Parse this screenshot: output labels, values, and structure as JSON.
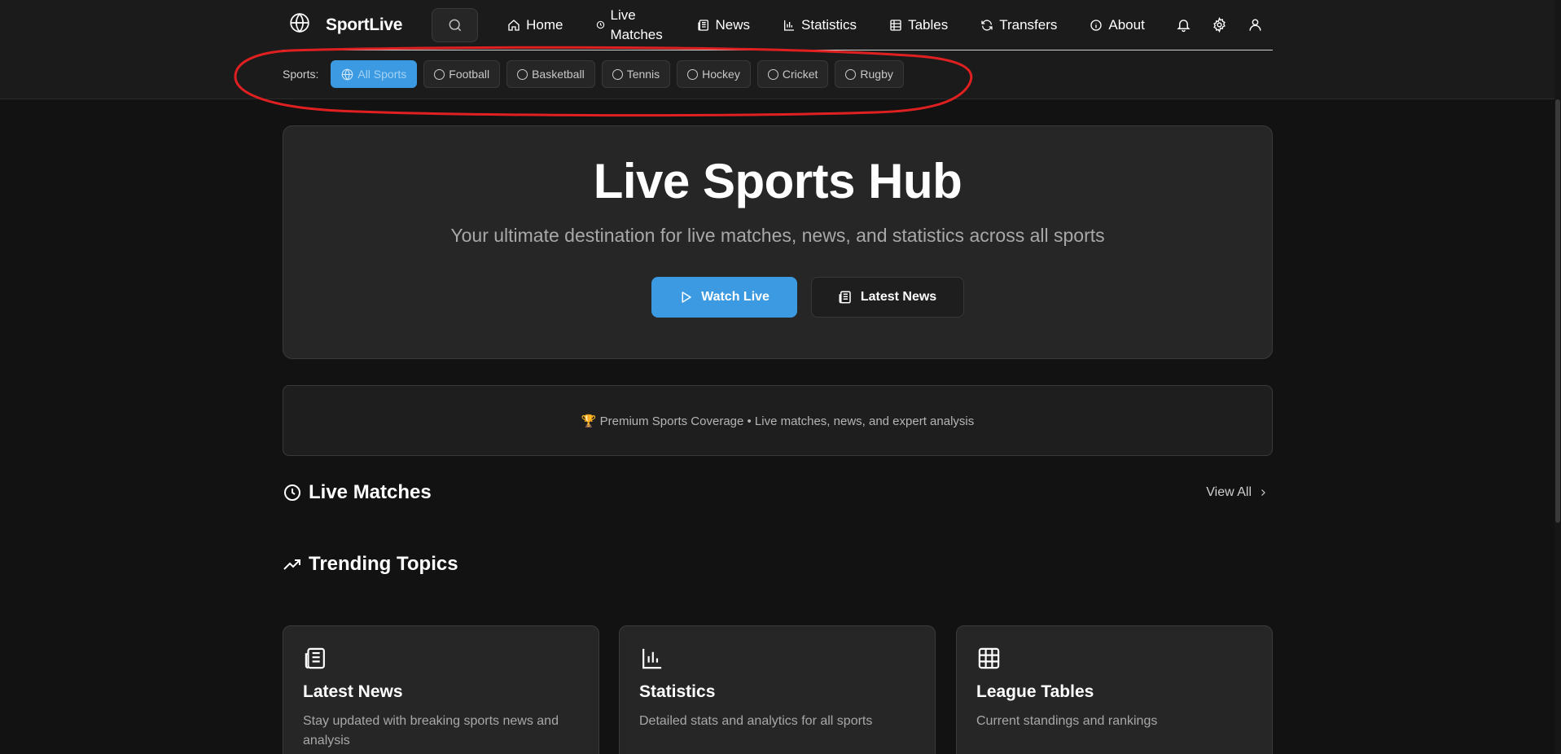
{
  "header": {
    "brand": "SportLive",
    "nav": {
      "home": "Home",
      "live_matches": "Live Matches",
      "news": "News",
      "statistics": "Statistics",
      "tables": "Tables",
      "transfers": "Transfers",
      "about": "About"
    },
    "icons": [
      "globe-icon",
      "search-icon",
      "home-icon",
      "clock-icon",
      "newspaper-icon",
      "bar-chart-icon",
      "table-icon",
      "refresh-icon",
      "info-icon",
      "bell-icon",
      "gear-icon",
      "user-icon"
    ]
  },
  "sports_filter": {
    "label": "Sports:",
    "options": [
      "All Sports",
      "Football",
      "Basketball",
      "Tennis",
      "Hockey",
      "Cricket",
      "Rugby"
    ],
    "selected": "All Sports"
  },
  "hero": {
    "title": "Live Sports Hub",
    "subtitle": "Your ultimate destination for live matches, news, and statistics across all sports",
    "primary_button": "Watch Live",
    "secondary_button": "Latest News"
  },
  "banner": {
    "text": "🏆 Premium Sports Coverage • Live matches, news, and expert analysis"
  },
  "live_matches": {
    "title": "Live Matches",
    "view_all": "View All"
  },
  "trending": {
    "title": "Trending Topics"
  },
  "cards": [
    {
      "title": "Latest News",
      "description": "Stay updated with breaking sports news and analysis",
      "icon": "newspaper-icon"
    },
    {
      "title": "Statistics",
      "description": "Detailed stats and analytics for all sports",
      "icon": "bar-chart-icon"
    },
    {
      "title": "League Tables",
      "description": "Current standings and rankings",
      "icon": "table-icon"
    }
  ],
  "colors": {
    "accent": "#3b9ae1",
    "background": "#121212",
    "surface": "#262626",
    "annotation": "#e02020"
  }
}
